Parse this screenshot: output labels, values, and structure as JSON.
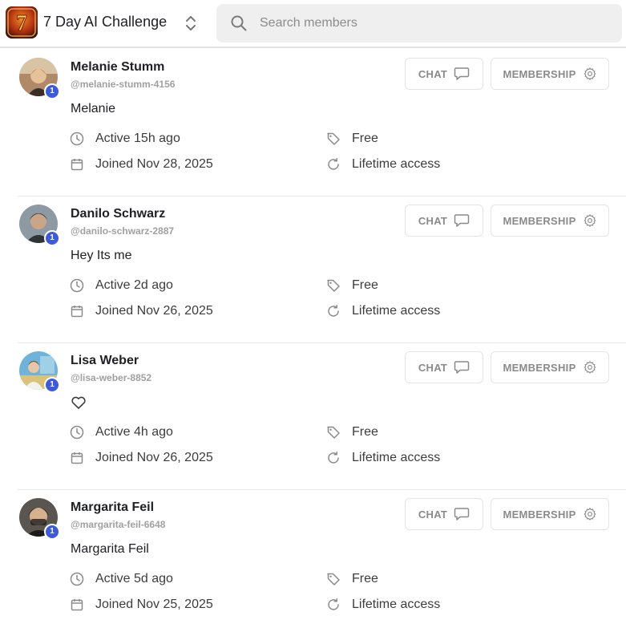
{
  "header": {
    "group_name": "7 Day AI Challenge",
    "logo_text": "7",
    "search_placeholder": "Search members"
  },
  "buttons": {
    "chat_label": "CHAT",
    "membership_label": "MEMBERSHIP"
  },
  "members": [
    {
      "name": "Melanie Stumm",
      "handle": "@melanie-stumm-4156",
      "bio": "Melanie",
      "level": "1",
      "active": "Active 15h ago",
      "joined": "Joined Nov 28, 2025",
      "price": "Free",
      "access": "Lifetime access"
    },
    {
      "name": "Danilo Schwarz",
      "handle": "@danilo-schwarz-2887",
      "bio": "Hey Its me",
      "level": "1",
      "active": "Active 2d ago",
      "joined": "Joined Nov 26, 2025",
      "price": "Free",
      "access": "Lifetime access"
    },
    {
      "name": "Lisa Weber",
      "handle": "@lisa-weber-8852",
      "bio": "",
      "bio_icon": "heart-outline-icon",
      "level": "1",
      "active": "Active 4h ago",
      "joined": "Joined Nov 26, 2025",
      "price": "Free",
      "access": "Lifetime access"
    },
    {
      "name": "Margarita Feil",
      "handle": "@margarita-feil-6648",
      "bio": "Margarita Feil",
      "level": "1",
      "active": "Active 5d ago",
      "joined": "Joined Nov 25, 2025",
      "price": "Free",
      "access": "Lifetime access"
    }
  ],
  "colors": {
    "level_badge": "#3b5bdb",
    "muted_text": "#a0a0a0",
    "search_bg": "#efefef",
    "divider": "#e8e8e8"
  }
}
